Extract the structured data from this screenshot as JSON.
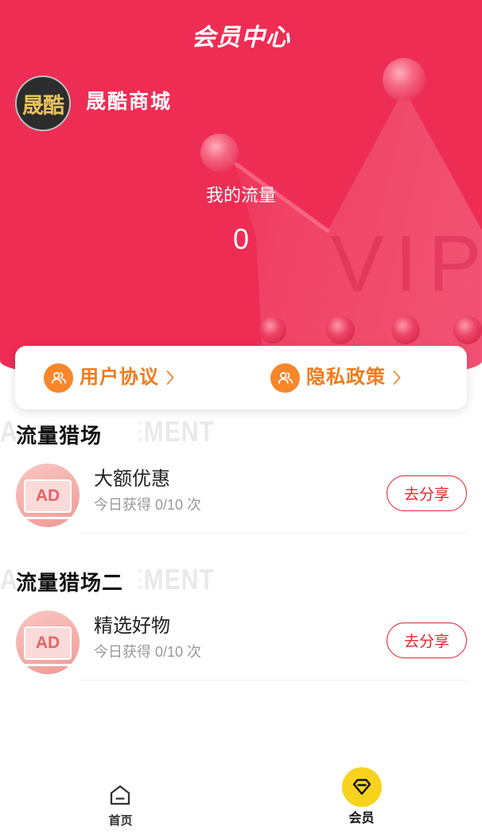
{
  "header": {
    "title": "会员中心",
    "avatar_text": "晟酷",
    "shop_name": "晟酷商城",
    "flow_label": "我的流量",
    "flow_value": "0",
    "bg_text": "VIP"
  },
  "links": [
    {
      "label": "用户协议",
      "icon": "users-icon",
      "chevron_icon": "chevron-right-icon"
    },
    {
      "label": "隐私政策",
      "icon": "users-icon",
      "chevron_icon": "chevron-right-icon"
    }
  ],
  "sections": [
    {
      "watermark": "ADVERTISEMENT",
      "title": "流量猎场",
      "items": [
        {
          "icon": "ad-icon",
          "icon_text": "AD",
          "name": "大额优惠",
          "progress": "今日获得 0/10 次",
          "button": "去分享"
        }
      ]
    },
    {
      "watermark": "ADVERTISEMENT",
      "title": "流量猎场二",
      "items": [
        {
          "icon": "ad-icon",
          "icon_text": "AD",
          "name": "精选好物",
          "progress": "今日获得 0/10 次",
          "button": "去分享"
        }
      ]
    }
  ],
  "tabbar": [
    {
      "label": "首页",
      "icon": "home-icon",
      "active": false
    },
    {
      "label": "会员",
      "icon": "diamond-icon",
      "active": true
    }
  ],
  "colors": {
    "header_bg": "#EE2D55",
    "link_orange": "#F27A1A",
    "share_red": "#E5242F",
    "active_tab_bg": "#F7D31E",
    "avatar_text": "#E8C25E"
  }
}
